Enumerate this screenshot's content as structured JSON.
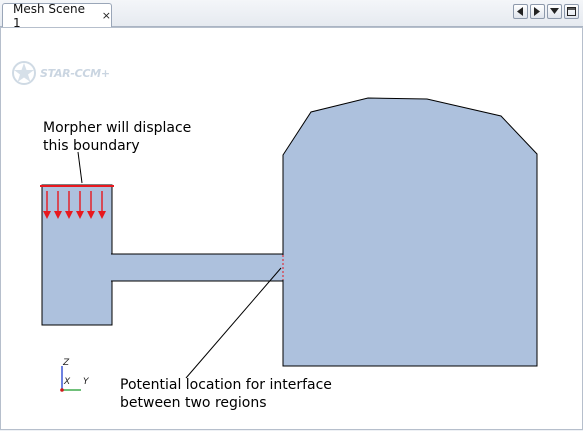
{
  "tab": {
    "title": "Mesh Scene 1",
    "close_symbol": "×"
  },
  "logo": {
    "text": "STAR-CCM+"
  },
  "annotations": {
    "morpher_line1": "Morpher will displace",
    "morpher_line2": "this boundary",
    "interface_line1": "Potential location for interface",
    "interface_line2": "between two regions"
  },
  "triad": {
    "z": "Z",
    "x": "X",
    "y": "Y"
  },
  "colors": {
    "geometry_fill": "#adc1dd",
    "boundary_highlight": "#e8181e",
    "axis_z": "#1f3fd0",
    "axis_y": "#1a9a2a",
    "axis_x": "#d01a1a"
  }
}
